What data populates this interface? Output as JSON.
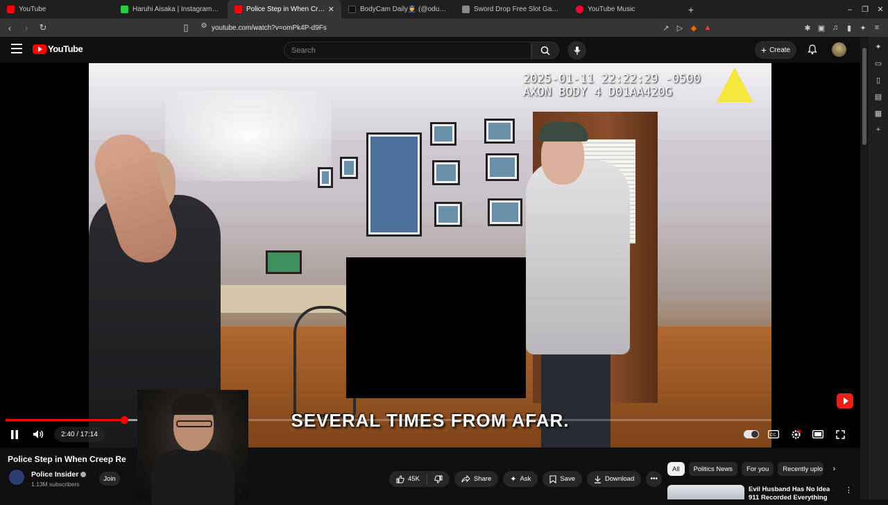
{
  "browser": {
    "tabs": [
      {
        "title": "YouTube",
        "color": "#ff0000",
        "active": false
      },
      {
        "title": "Haruhi Aisaka | Instagram | Lin",
        "color": "#2ecc40",
        "active": false
      },
      {
        "title": "Police Step in When Creep",
        "color": "#ff0000",
        "active": true,
        "close": "✕"
      },
      {
        "title": "BodyCam Daily👮 (@odutqgp71",
        "color": "#111111",
        "active": false
      },
      {
        "title": "Sword Drop Free Slot Game by",
        "color": "#8a8a8a",
        "active": false
      },
      {
        "title": "YouTube Music",
        "color": "#ff0033",
        "active": false
      }
    ],
    "new_tab": "+",
    "url": "youtube.com/watch?v=omPk4P-d9Fs"
  },
  "header": {
    "logo_text": "YouTube",
    "search_placeholder": "Search",
    "create_label": "Create"
  },
  "video": {
    "bodycam_line1": "2025-01-11 22:22:29 -0500",
    "bodycam_line2": "AXON BODY 4 D01AA420G",
    "caption": "SEVERAL TIMES FROM AFAR.",
    "time_display": "2:40 / 17:14",
    "progress_fraction": 0.155,
    "buffer_fraction": 0.2
  },
  "info": {
    "title": "Police Step in When Creep Re",
    "channel_name": "Police Insider",
    "subscribers": "1.13M subscribers",
    "join_label": "Join",
    "like_count": "45K",
    "share_label": "Share",
    "ask_label": "Ask",
    "save_label": "Save",
    "download_label": "Download"
  },
  "chips": [
    "All",
    "Politics News",
    "For you",
    "Recently uplo"
  ],
  "recommendation": {
    "title": "Evil Husband Has No Idea 911 Recorded Everything"
  }
}
